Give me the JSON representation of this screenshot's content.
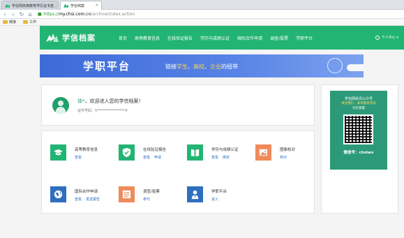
{
  "browser": {
    "tabs": [
      {
        "label": "学信网高等教育学历证书查…"
      },
      {
        "label": "学信档案"
      }
    ],
    "url_https": "https://",
    "url_host": "my.chsi.com.cn",
    "url_path": "/archive/index.action",
    "bookmarks": [
      {
        "label": "链接"
      },
      {
        "label": "工作"
      }
    ]
  },
  "header": {
    "logo_text": "学信档案",
    "nav": [
      "首页",
      "高等教育信息",
      "在线验证报告",
      "学历与成绩认证",
      "国际合作申请",
      "调查/投票",
      "学职平台"
    ],
    "user_menu": "个人中心 ▾"
  },
  "banner": {
    "title": "学职平台",
    "slogan_prefix": "链接",
    "slogan_a": "学生",
    "slogan_sep1": "、",
    "slogan_b": "高校",
    "slogan_sep2": "、",
    "slogan_c": "企业",
    "slogan_suffix": "的纽带"
  },
  "welcome": {
    "name": "徐*",
    "greeting": "，欢迎进入您的学信档案！",
    "cert_label": "证件号码：",
    "cert_value": "5****************4"
  },
  "tiles": [
    {
      "name": "高等教育信息",
      "links": [
        "查看"
      ],
      "color": "#22b473",
      "icon": "graduation-cap-icon"
    },
    {
      "name": "在线验证报告",
      "links": [
        "查看",
        "申请"
      ],
      "color": "#22b473",
      "icon": "shield-check-icon"
    },
    {
      "name": "学历与成绩认证",
      "links": [
        "查看",
        "绑定"
      ],
      "color": "#22b473",
      "icon": "book-icon"
    },
    {
      "name": "图像校对",
      "links": [
        "校对"
      ],
      "color": "#ef8a5a",
      "icon": "image-icon"
    },
    {
      "name": "国际合作申请",
      "links": [
        "查看",
        "发送报告"
      ],
      "color": "#2f6fbf",
      "icon": "globe-icon"
    },
    {
      "name": "调查/投票",
      "links": [
        "参与"
      ],
      "color": "#ef8a5a",
      "icon": "list-icon"
    },
    {
      "name": "学职平台",
      "links": [
        "进入"
      ],
      "color": "#2f6fbf",
      "icon": "person-icon"
    }
  ],
  "side": {
    "qr_title": "学信网资讯公众号",
    "qr_sub": "关注我们，高等教育资讯",
    "qr_sub2": "尽在掌握",
    "wechat": "微信号：chsiwx"
  }
}
